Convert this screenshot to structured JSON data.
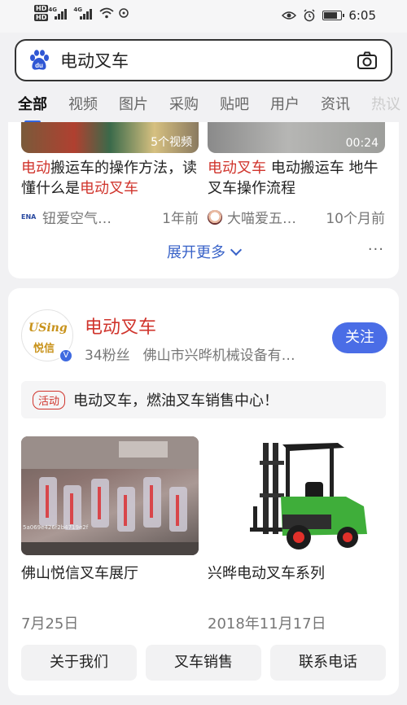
{
  "status_bar": {
    "hd_labels": [
      "HD",
      "HD"
    ],
    "network_labels": [
      "4G",
      "4G"
    ],
    "time": "6:05",
    "battery_level": 0.8,
    "icons": [
      "hd-icon",
      "signal-icon",
      "wifi-icon",
      "eye-icon",
      "alarm-icon",
      "battery-icon"
    ]
  },
  "search": {
    "query": "电动叉车",
    "icons": [
      "baidu-paw-icon",
      "camera-icon"
    ]
  },
  "tabs": [
    "全部",
    "视频",
    "图片",
    "采购",
    "贴吧",
    "用户",
    "资讯",
    "热议"
  ],
  "video_results": [
    {
      "badge": "5个视频",
      "title_highlight_1": "电动",
      "title_plain_1": "搬运车的操作方法，读懂什么是",
      "title_highlight_2": "电动叉车",
      "source": "钮爱空气…",
      "source_icon_text": "ENA",
      "time": "1年前"
    },
    {
      "badge": "00:24",
      "title_highlight_1": "电动叉车",
      "title_plain_1": " 电动搬运车 地牛叉车操作流程",
      "source": "大喵爱五…",
      "time": "10个月前"
    }
  ],
  "expand_label": "展开更多",
  "more_dots": "···",
  "account": {
    "avatar_line1": "USing",
    "avatar_line2": "悦信",
    "verified_mark": "V",
    "name": "电动叉车",
    "fans": "34粉丝",
    "company": "佛山市兴晔机械设备有…",
    "follow_label": "关注",
    "promo_tag": "活动",
    "promo_text": "电动叉车，燃油叉车销售中心！",
    "posts": [
      {
        "title": "佛山悦信叉车展厅",
        "date": "7月25日",
        "image_caption": "5a069e426f2b4719e2f"
      },
      {
        "title": "兴晔电动叉车系列",
        "date": "2018年11月17日"
      }
    ],
    "buttons": [
      "关于我们",
      "叉车销售",
      "联系电话"
    ]
  },
  "colors": {
    "accent": "#4a6de6",
    "highlight": "#d0342c",
    "forklift_green": "#3fae3a"
  }
}
